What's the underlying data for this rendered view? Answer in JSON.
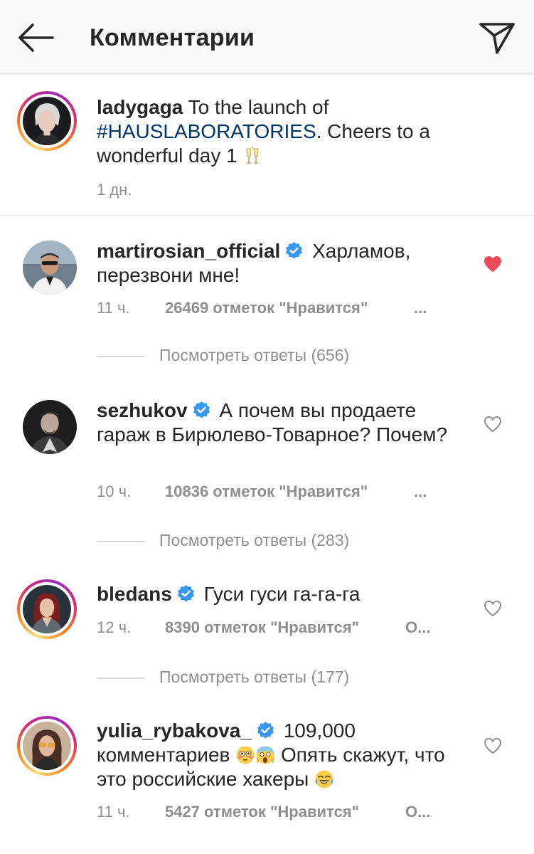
{
  "header": {
    "title": "Комментарии",
    "back_icon": "arrow-left-icon",
    "share_icon": "paper-plane-icon"
  },
  "caption": {
    "username": "ladygaga",
    "text_before": " To the launch of ",
    "hashtag": "#HAUSLABORATORIES",
    "text_after": ". Cheers to a wonderful day 1 ",
    "emoji": "clinking-glasses",
    "time": "1 дн."
  },
  "comments": [
    {
      "username": "martirosian_official",
      "verified": true,
      "text": " Харламов, перезвони мне!",
      "time": "11 ч.",
      "likes": "26469 отметок \"Нравится\"",
      "reply": "...",
      "liked": true,
      "view_replies": "Посмотреть ответы (656)"
    },
    {
      "username": "sezhukov",
      "verified": true,
      "text": " А почем вы продаете гараж в Бирюлево-Товарное? Почем?",
      "time": "10 ч.",
      "likes": "10836 отметок \"Нравится\"",
      "reply": "...",
      "liked": false,
      "view_replies": "Посмотреть ответы (283)"
    },
    {
      "username": "bledans",
      "verified": true,
      "text": " Гуси гуси га-га-га",
      "time": "12 ч.",
      "likes": "8390 отметок \"Нравится\"",
      "reply": "О...",
      "liked": false,
      "view_replies": "Посмотреть ответы (177)"
    },
    {
      "username": "yulia_rybakova_",
      "verified": true,
      "text_before": " 109,000 комментариев ",
      "text_middle": " Опять скажут, что это российские хакеры ",
      "time": "11 ч.",
      "likes": "5427 отметок \"Нравится\"",
      "reply": "О...",
      "liked": false
    }
  ],
  "colors": {
    "link": "#003569",
    "muted": "#8e8e8e",
    "verified": "#3897f0",
    "like_red": "#ed4956"
  }
}
